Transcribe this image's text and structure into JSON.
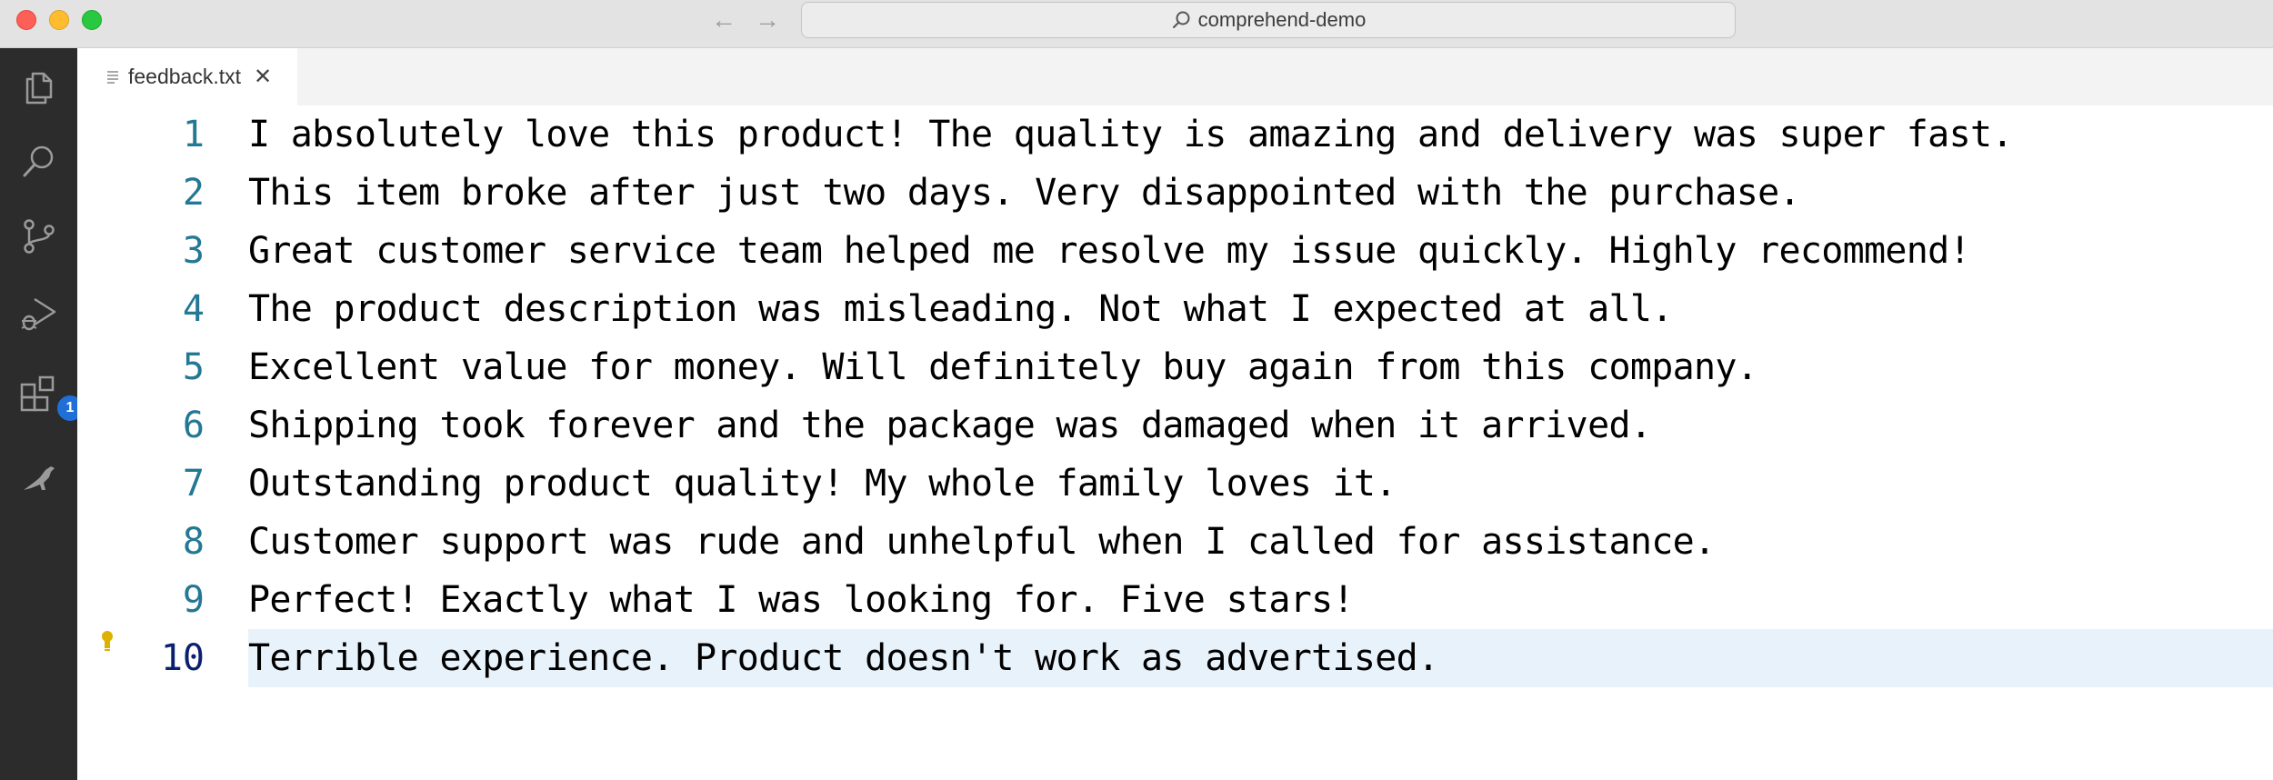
{
  "window": {
    "search_label": "comprehend-demo"
  },
  "activity_bar": {
    "icons": [
      "files-icon",
      "search-icon",
      "source-control-icon",
      "run-debug-icon",
      "extensions-icon",
      "kangaroo-icon"
    ],
    "extensions_badge": "1"
  },
  "tab": {
    "label": "feedback.txt"
  },
  "editor": {
    "current_line": 10,
    "lines": [
      {
        "number": "1",
        "text": "I absolutely love this product! The quality is amazing and delivery was super fast."
      },
      {
        "number": "2",
        "text": "This item broke after just two days. Very disappointed with the purchase."
      },
      {
        "number": "3",
        "text": "Great customer service team helped me resolve my issue quickly. Highly recommend!"
      },
      {
        "number": "4",
        "text": "The product description was misleading. Not what I expected at all."
      },
      {
        "number": "5",
        "text": "Excellent value for money. Will definitely buy again from this company."
      },
      {
        "number": "6",
        "text": "Shipping took forever and the package was damaged when it arrived."
      },
      {
        "number": "7",
        "text": "Outstanding product quality! My whole family loves it."
      },
      {
        "number": "8",
        "text": "Customer support was rude and unhelpful when I called for assistance."
      },
      {
        "number": "9",
        "text": "Perfect! Exactly what I was looking for. Five stars!"
      },
      {
        "number": "10",
        "text": "Terrible experience. Product doesn't work as advertised."
      }
    ]
  },
  "colors": {
    "activity_bar_bg": "#2c2c2c",
    "line_number": "#237893",
    "current_line_highlight": "#e8f2fb",
    "badge": "#1f6fd6"
  }
}
